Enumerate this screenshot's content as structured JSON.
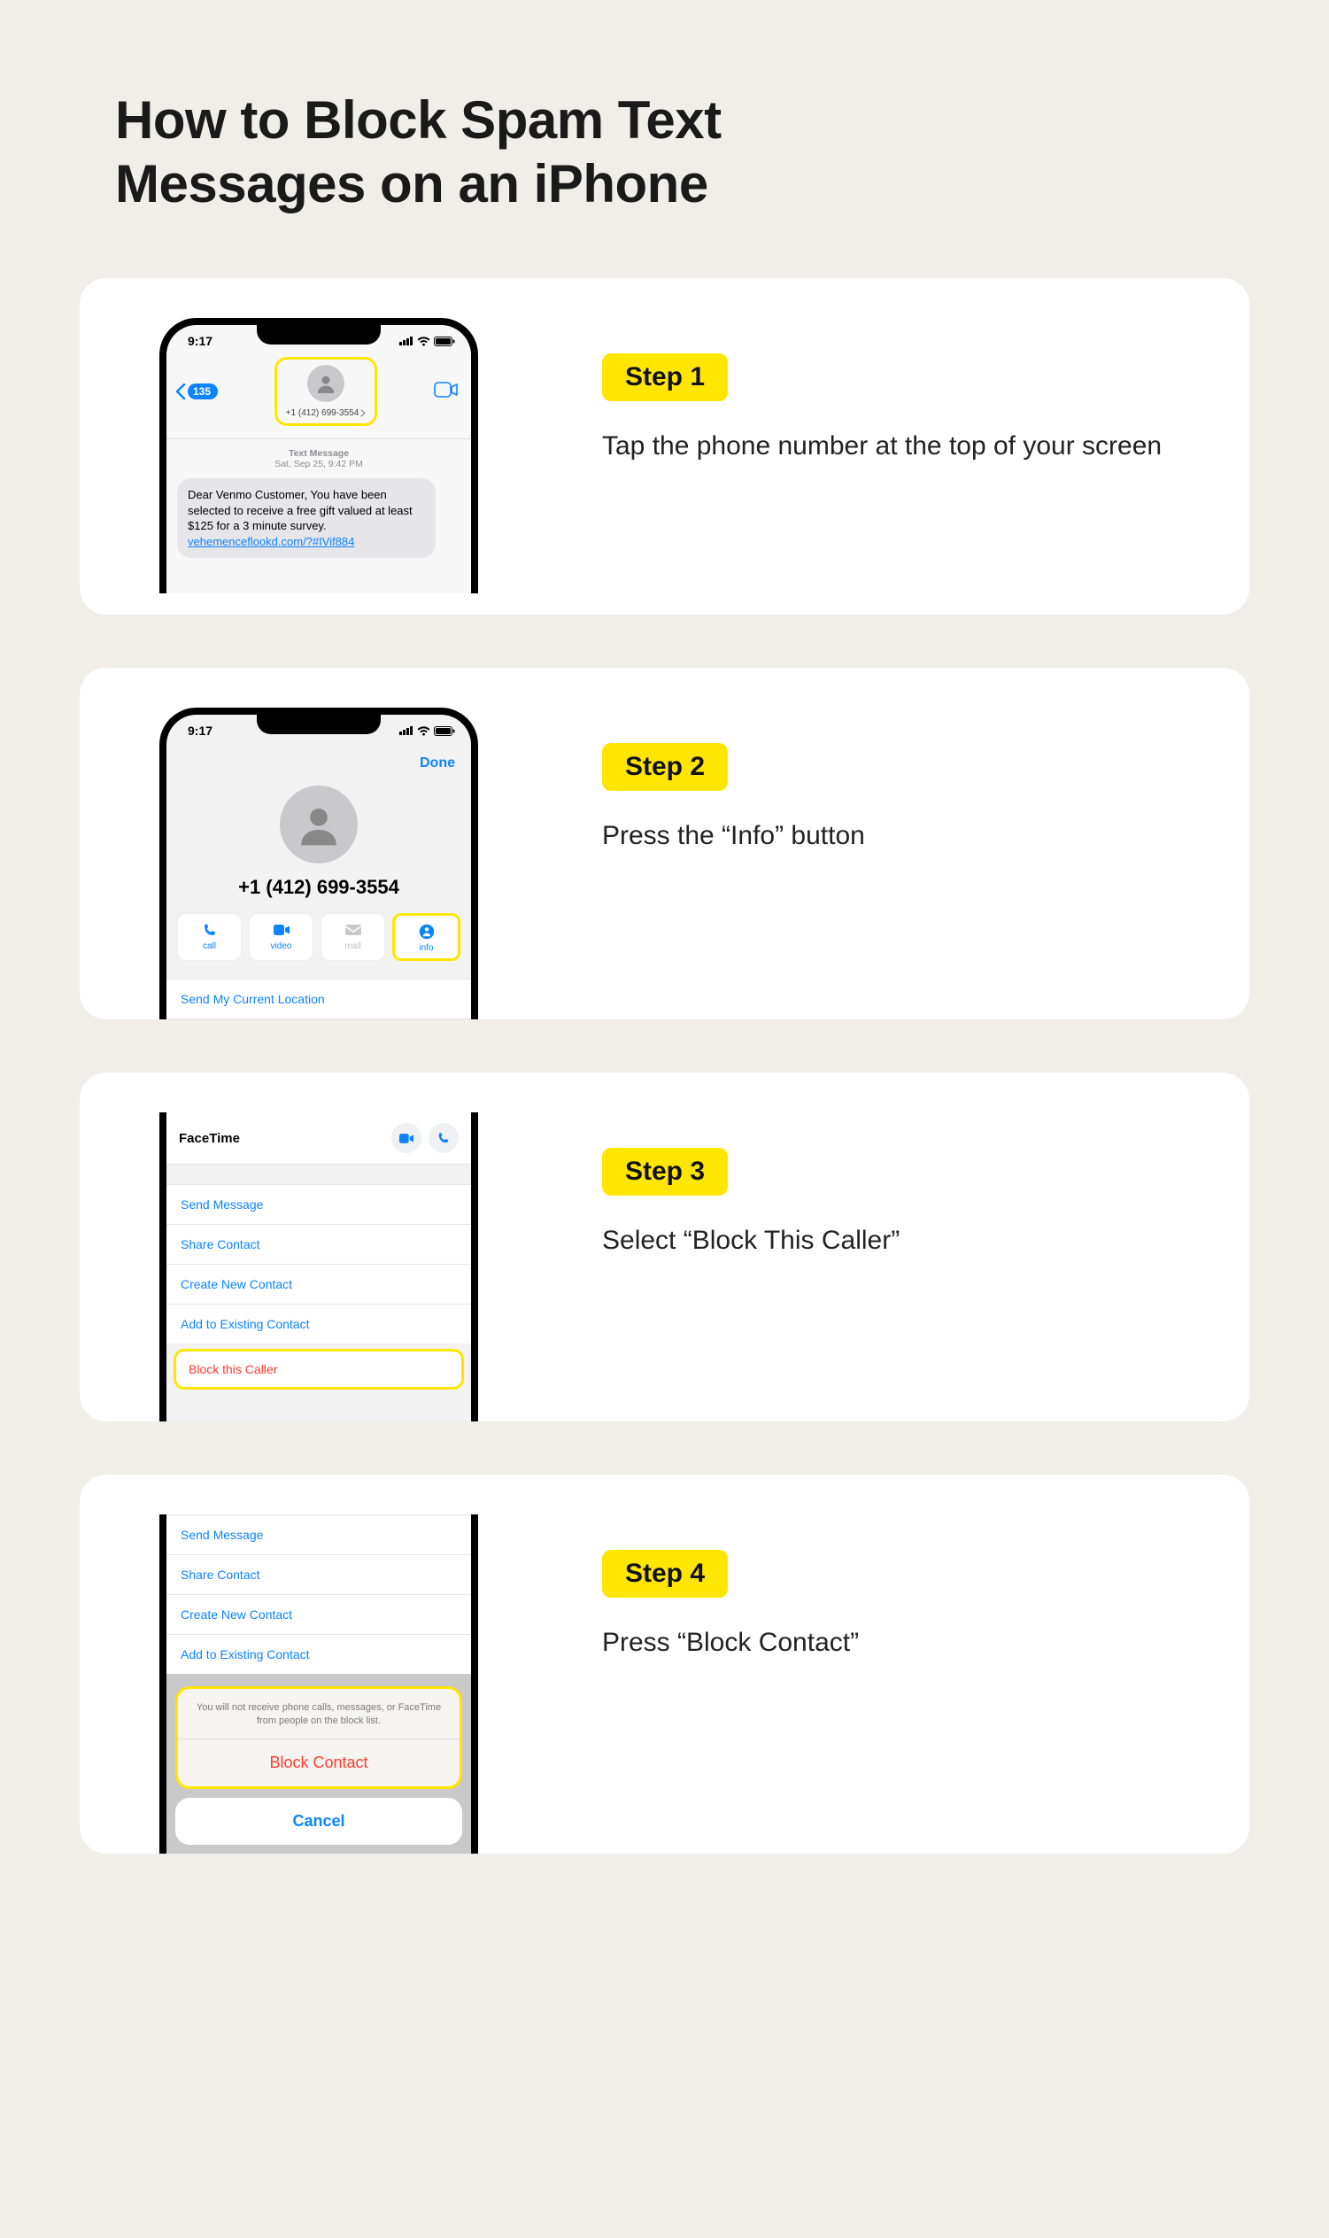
{
  "title": "How to Block Spam Text Messages on an iPhone",
  "steps": [
    {
      "badge": "Step 1",
      "desc": "Tap the phone number at the top of your screen"
    },
    {
      "badge": "Step 2",
      "desc": "Press the “Info” button"
    },
    {
      "badge": "Step 3",
      "desc": "Select “Block This Caller”"
    },
    {
      "badge": "Step 4",
      "desc": "Press “Block Contact”"
    }
  ],
  "phone": {
    "status_time": "9:17",
    "back_count": "135",
    "contact_number_short": "+1 (412) 699-3554",
    "meta_line1": "Text Message",
    "meta_line2": "Sat, Sep 25, 9:42 PM",
    "bubble_text": "Dear Venmo Customer, You have been selected to receive a free gift valued at least $125 for a 3 minute survey.",
    "bubble_link": "vehemenceflookd.com/?#IVif884",
    "done_label": "Done",
    "contact_number_big": "+1 (412) 699-3554",
    "actions": {
      "call": "call",
      "video": "video",
      "mail": "mail",
      "info": "info"
    },
    "send_location": "Send My Current Location",
    "facetime_label": "FaceTime",
    "menu": {
      "send_message": "Send Message",
      "share_contact": "Share Contact",
      "create_new": "Create New Contact",
      "add_existing": "Add to Existing Contact",
      "block_caller": "Block this Caller"
    },
    "sheet": {
      "msg": "You will not receive phone calls, messages, or FaceTime from people on the block list.",
      "block": "Block Contact",
      "cancel": "Cancel"
    }
  }
}
